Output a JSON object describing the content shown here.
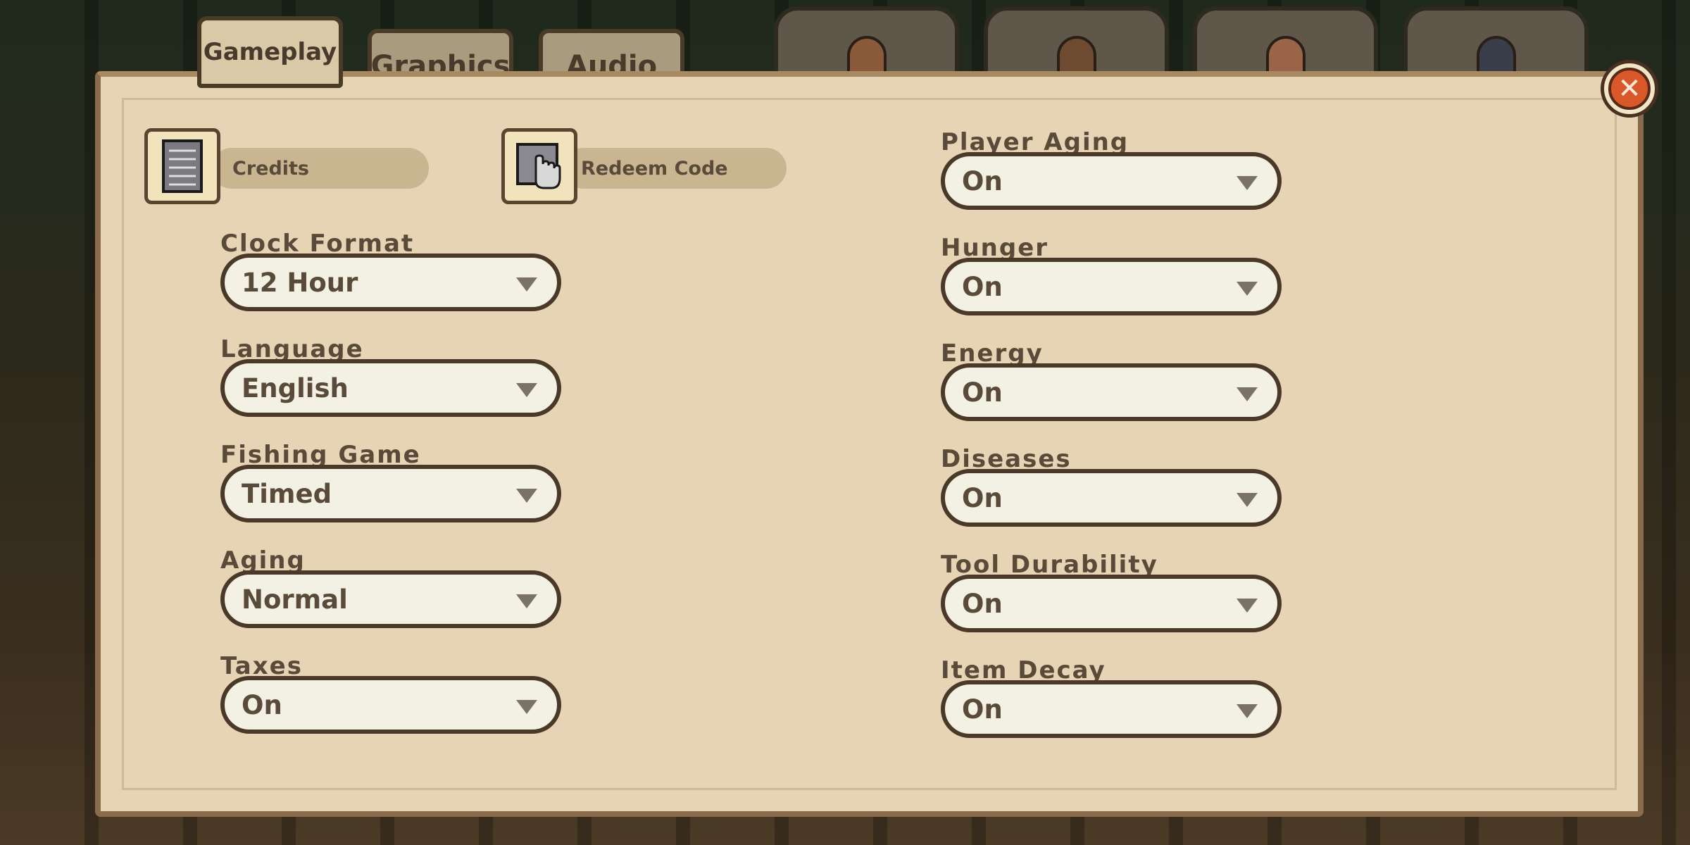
{
  "tabs": [
    {
      "label": "Gameplay",
      "active": true
    },
    {
      "label": "Graphics",
      "active": false
    },
    {
      "label": "Audio",
      "active": false
    }
  ],
  "character_tabs": [
    {
      "icon": "head-icon"
    },
    {
      "icon": "hair-icon"
    },
    {
      "icon": "helmet-icon"
    },
    {
      "icon": "boot-icon"
    }
  ],
  "buttons": {
    "credits": "Credits",
    "redeem": "Redeem Code"
  },
  "left_settings": [
    {
      "label": "Clock Format",
      "value": "12 Hour"
    },
    {
      "label": "Language",
      "value": "English"
    },
    {
      "label": "Fishing Game",
      "value": "Timed"
    },
    {
      "label": "Aging",
      "value": "Normal"
    },
    {
      "label": "Taxes",
      "value": "On"
    }
  ],
  "right_settings": [
    {
      "label": "Player Aging",
      "value": "On"
    },
    {
      "label": "Hunger",
      "value": "On"
    },
    {
      "label": "Energy",
      "value": "On"
    },
    {
      "label": "Diseases",
      "value": "On"
    },
    {
      "label": "Tool Durability",
      "value": "On"
    },
    {
      "label": "Item Decay",
      "value": "On"
    }
  ],
  "colors": {
    "panel": "#e6d4b4",
    "close": "#d8582a",
    "dropdown": "#f3f1e4"
  }
}
